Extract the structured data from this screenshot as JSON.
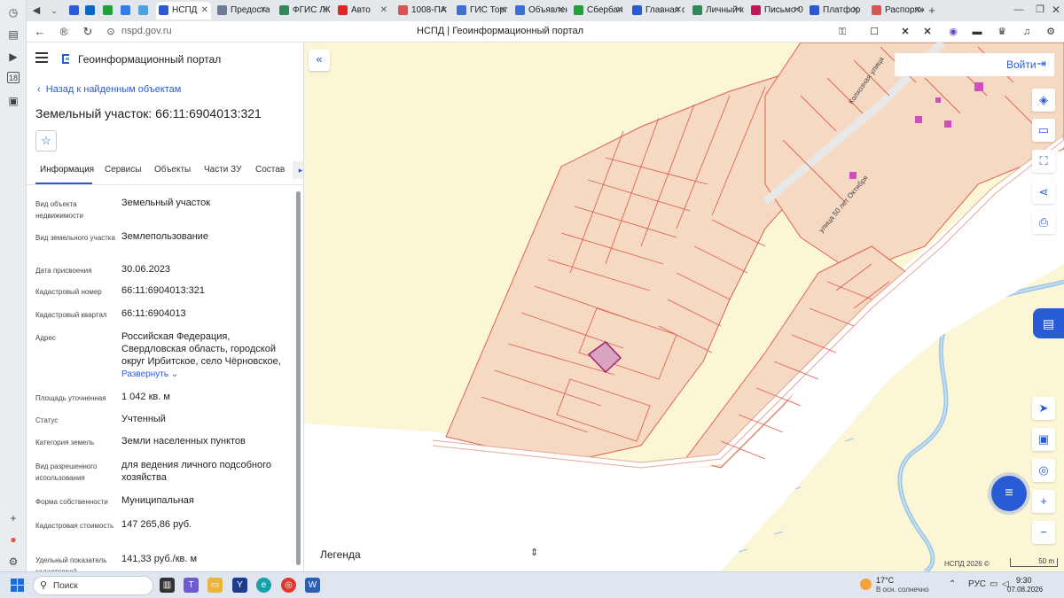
{
  "browser": {
    "tabs": [
      {
        "label": "НСПД",
        "color": "#2a5bd7",
        "active": true
      },
      {
        "label": "Предоста",
        "color": "#6b7d94"
      },
      {
        "label": "ФГИС ЛК",
        "color": "#2e8b57"
      },
      {
        "label": "Авто",
        "color": "#e02424"
      },
      {
        "label": "1008-ПА",
        "color": "#d9534f"
      },
      {
        "label": "ГИС Торг",
        "color": "#3b6fd4"
      },
      {
        "label": "Объявлен",
        "color": "#3b6fd4"
      },
      {
        "label": "Сбербан",
        "color": "#21a038"
      },
      {
        "label": "Главная с",
        "color": "#2a5bd7"
      },
      {
        "label": "Личный к",
        "color": "#2e8b57"
      },
      {
        "label": "Письмо 0",
        "color": "#c2185b"
      },
      {
        "label": "Платфор",
        "color": "#2a5bd7"
      },
      {
        "label": "Распоряж",
        "color": "#d9534f"
      }
    ],
    "url": "nspd.gov.ru",
    "page_title": "НСПД | Геоинформационный портал"
  },
  "panel": {
    "portal_title": "Геоинформационный портал",
    "back_label": "Назад к найденным объектам",
    "object_title": "Земельный участок: 66:11:6904013:321",
    "tabs": [
      "Информация",
      "Сервисы",
      "Объекты",
      "Части ЗУ",
      "Состав"
    ],
    "properties": [
      {
        "label": "Вид объекта недвижимости",
        "value": "Земельный участок"
      },
      {
        "label": "Вид земельного участка",
        "value": "Землепользование"
      },
      {
        "label": "Дата присвоения",
        "value": "30.06.2023"
      },
      {
        "label": "Кадастровый номер",
        "value": "66:11:6904013:321"
      },
      {
        "label": "Кадастровый квартал",
        "value": "66:11:6904013"
      },
      {
        "label": "Адрес",
        "value": "Российская Федерация, Свердловская область, городской округ Ирбитское, село Чёрновское,"
      },
      {
        "label": "Площадь уточненная",
        "value": "1 042 кв. м"
      },
      {
        "label": "Статус",
        "value": "Учтенный"
      },
      {
        "label": "Категория земель",
        "value": "Земли населенных пунктов"
      },
      {
        "label": "Вид разрешенного использования",
        "value": "для ведения личного подсобного хозяйства"
      },
      {
        "label": "Форма собственности",
        "value": "Муниципальная"
      },
      {
        "label": "Кадастровая стоимость",
        "value": "147 265,86 руб."
      },
      {
        "label": "Удельный показатель кадастровой",
        "value": "141,33 руб./кв. м"
      }
    ],
    "expand_label": "Развернуть"
  },
  "map": {
    "login_label": "Войти",
    "legend_label": "Легенда",
    "copyright": "НСПД 2026 ©",
    "scale": "50 m",
    "street_1": "Колхозная улица",
    "street_2": "улица 50 лет Октября",
    "colors": {
      "parcel_fill": "#f5d9c3",
      "parcel_stroke": "#e0614f",
      "selected_fill": "#d9a4bf",
      "selected_stroke": "#a1216e",
      "river": "#9fc7e8",
      "field": "#faf6d6"
    }
  },
  "taskbar": {
    "search_label": "Поиск",
    "weather_temp": "17°C",
    "weather_desc": "В осн. солнечно",
    "lang": "РУС",
    "time": "9:30",
    "date": "07.08.2026"
  }
}
